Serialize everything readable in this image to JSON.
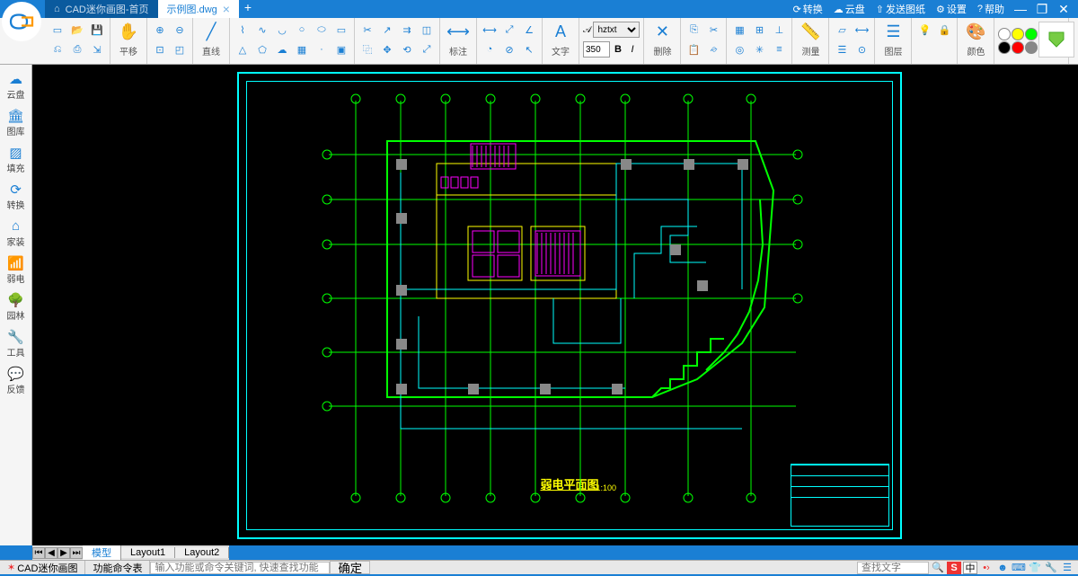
{
  "tabs": {
    "home": "CAD迷你画图-首页",
    "active": "示例图.dwg"
  },
  "titleRight": {
    "convert": "转换",
    "cloud": "云盘",
    "send": "发送图纸",
    "settings": "设置",
    "help": "帮助"
  },
  "toolLabels": {
    "pan": "平移",
    "line": "直线",
    "annotate": "标注",
    "text": "文字",
    "delete": "删除",
    "measure": "测量",
    "layer": "图层",
    "color": "颜色"
  },
  "font": {
    "name": "hztxt",
    "size": "350"
  },
  "sidebar": [
    "云盘",
    "图库",
    "填充",
    "转换",
    "家装",
    "弱电",
    "园林",
    "工具",
    "反馈"
  ],
  "layoutTabs": {
    "model": "模型",
    "l1": "Layout1",
    "l2": "Layout2"
  },
  "drawing": {
    "title": "弱电平面图",
    "scale": "1:100"
  },
  "status": {
    "app": "CAD迷你画图",
    "cmd": "功能命令表",
    "hint": "输入功能或命令关键词, 快速查找功能",
    "ok": "确定",
    "search": "查找文字",
    "ime": "中"
  },
  "colors": [
    "#fff",
    "#ff0",
    "#0f0",
    "#0ff",
    "#00f",
    "#000",
    "#f00",
    "#888",
    "#f0f",
    "#840"
  ]
}
